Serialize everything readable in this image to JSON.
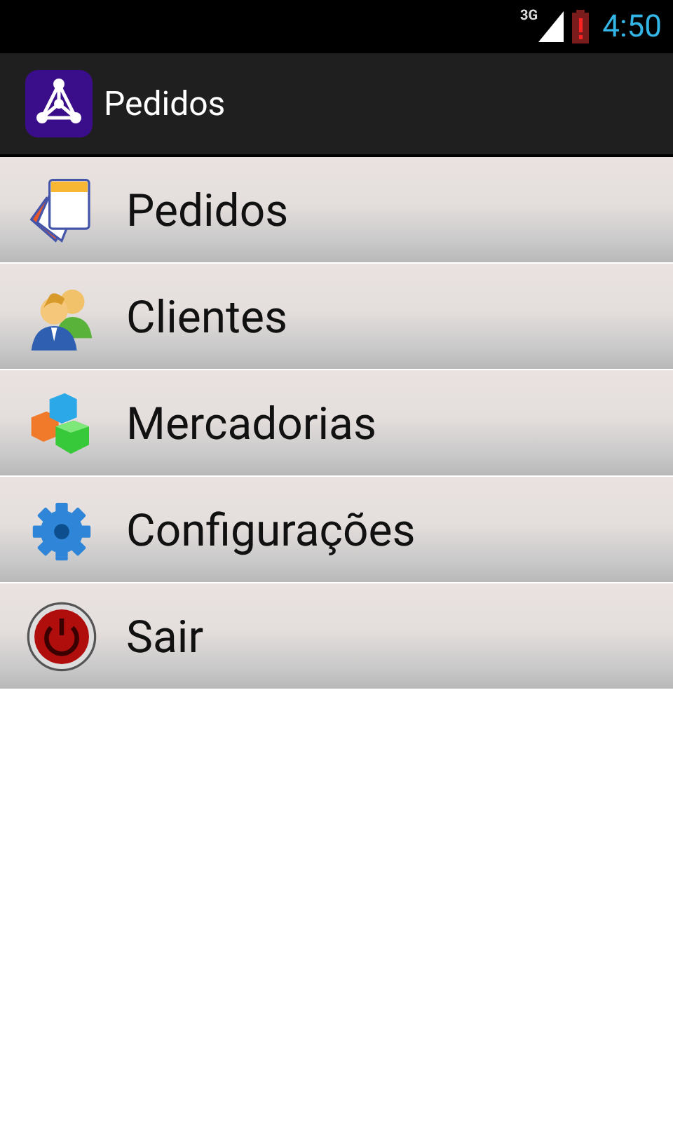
{
  "status_bar": {
    "network": "3G",
    "time": "4:50"
  },
  "action_bar": {
    "title": "Pedidos"
  },
  "menu": [
    {
      "label": "Pedidos",
      "kind": "documents"
    },
    {
      "label": "Clientes",
      "kind": "people"
    },
    {
      "label": "Mercadorias",
      "kind": "cubes"
    },
    {
      "label": "Configurações",
      "kind": "gear"
    },
    {
      "label": "Sair",
      "kind": "power"
    }
  ]
}
